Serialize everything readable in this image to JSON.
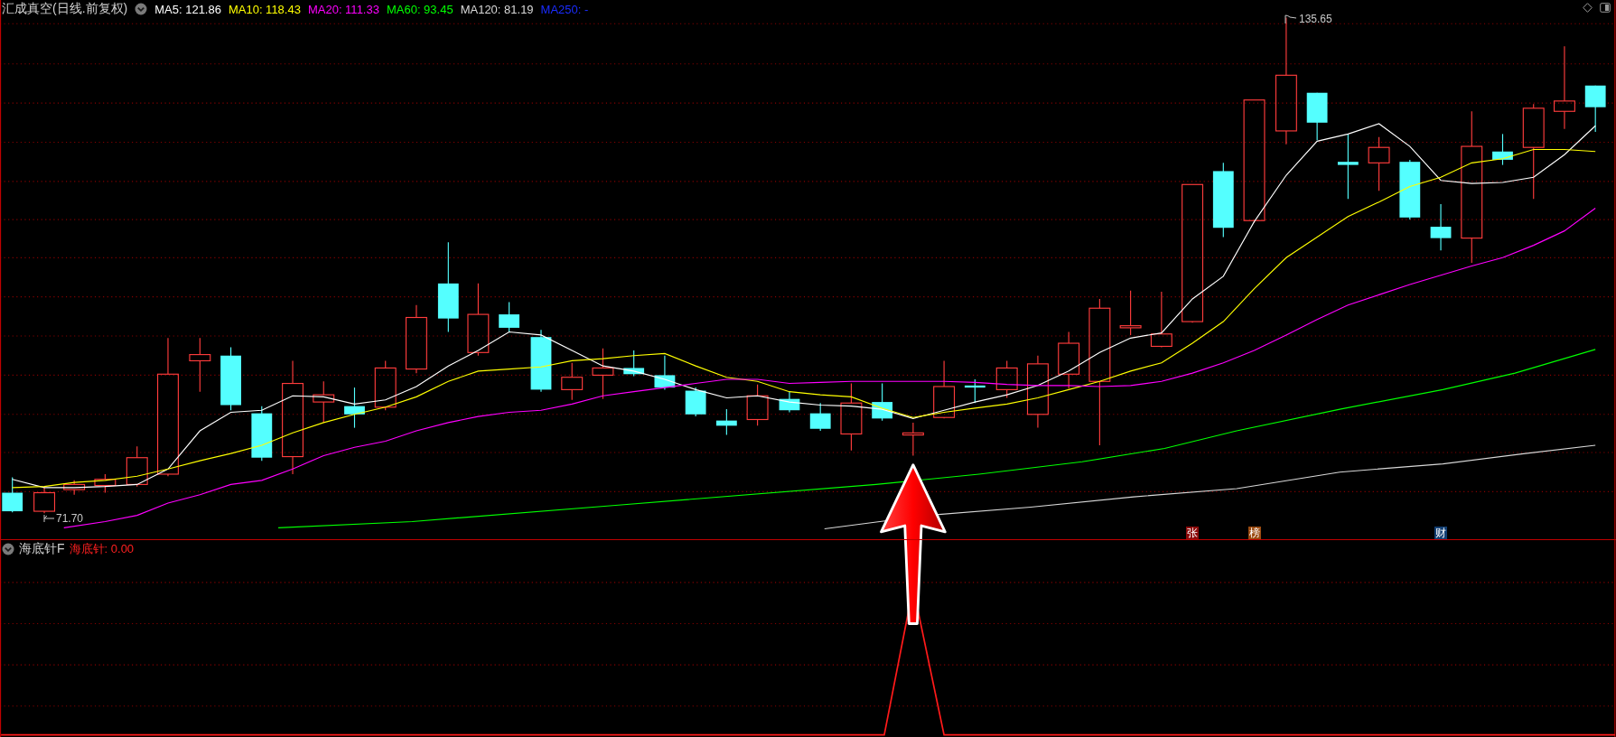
{
  "title": "汇成真空(日线.前复权)",
  "ma_legend": [
    {
      "label": "MA5: 121.86",
      "color": "#ffffff"
    },
    {
      "label": "MA10: 118.43",
      "color": "#ffff00"
    },
    {
      "label": "MA20: 111.33",
      "color": "#ff00ff"
    },
    {
      "label": "MA60: 93.45",
      "color": "#00ff00"
    },
    {
      "label": "MA120: 81.19",
      "color": "#d8d8d8"
    },
    {
      "label": "MA250: -",
      "color": "#1a2cff"
    }
  ],
  "high_label": "135.65",
  "low_label": "71.70",
  "event_badges": [
    {
      "label": "张",
      "color": "#8c0a0a"
    },
    {
      "label": "榜",
      "color": "#9a4a10"
    },
    {
      "label": "财",
      "color": "#123e72"
    }
  ],
  "indicator": {
    "name": "海底针F",
    "reading": "海底针: 0.00"
  }
}
